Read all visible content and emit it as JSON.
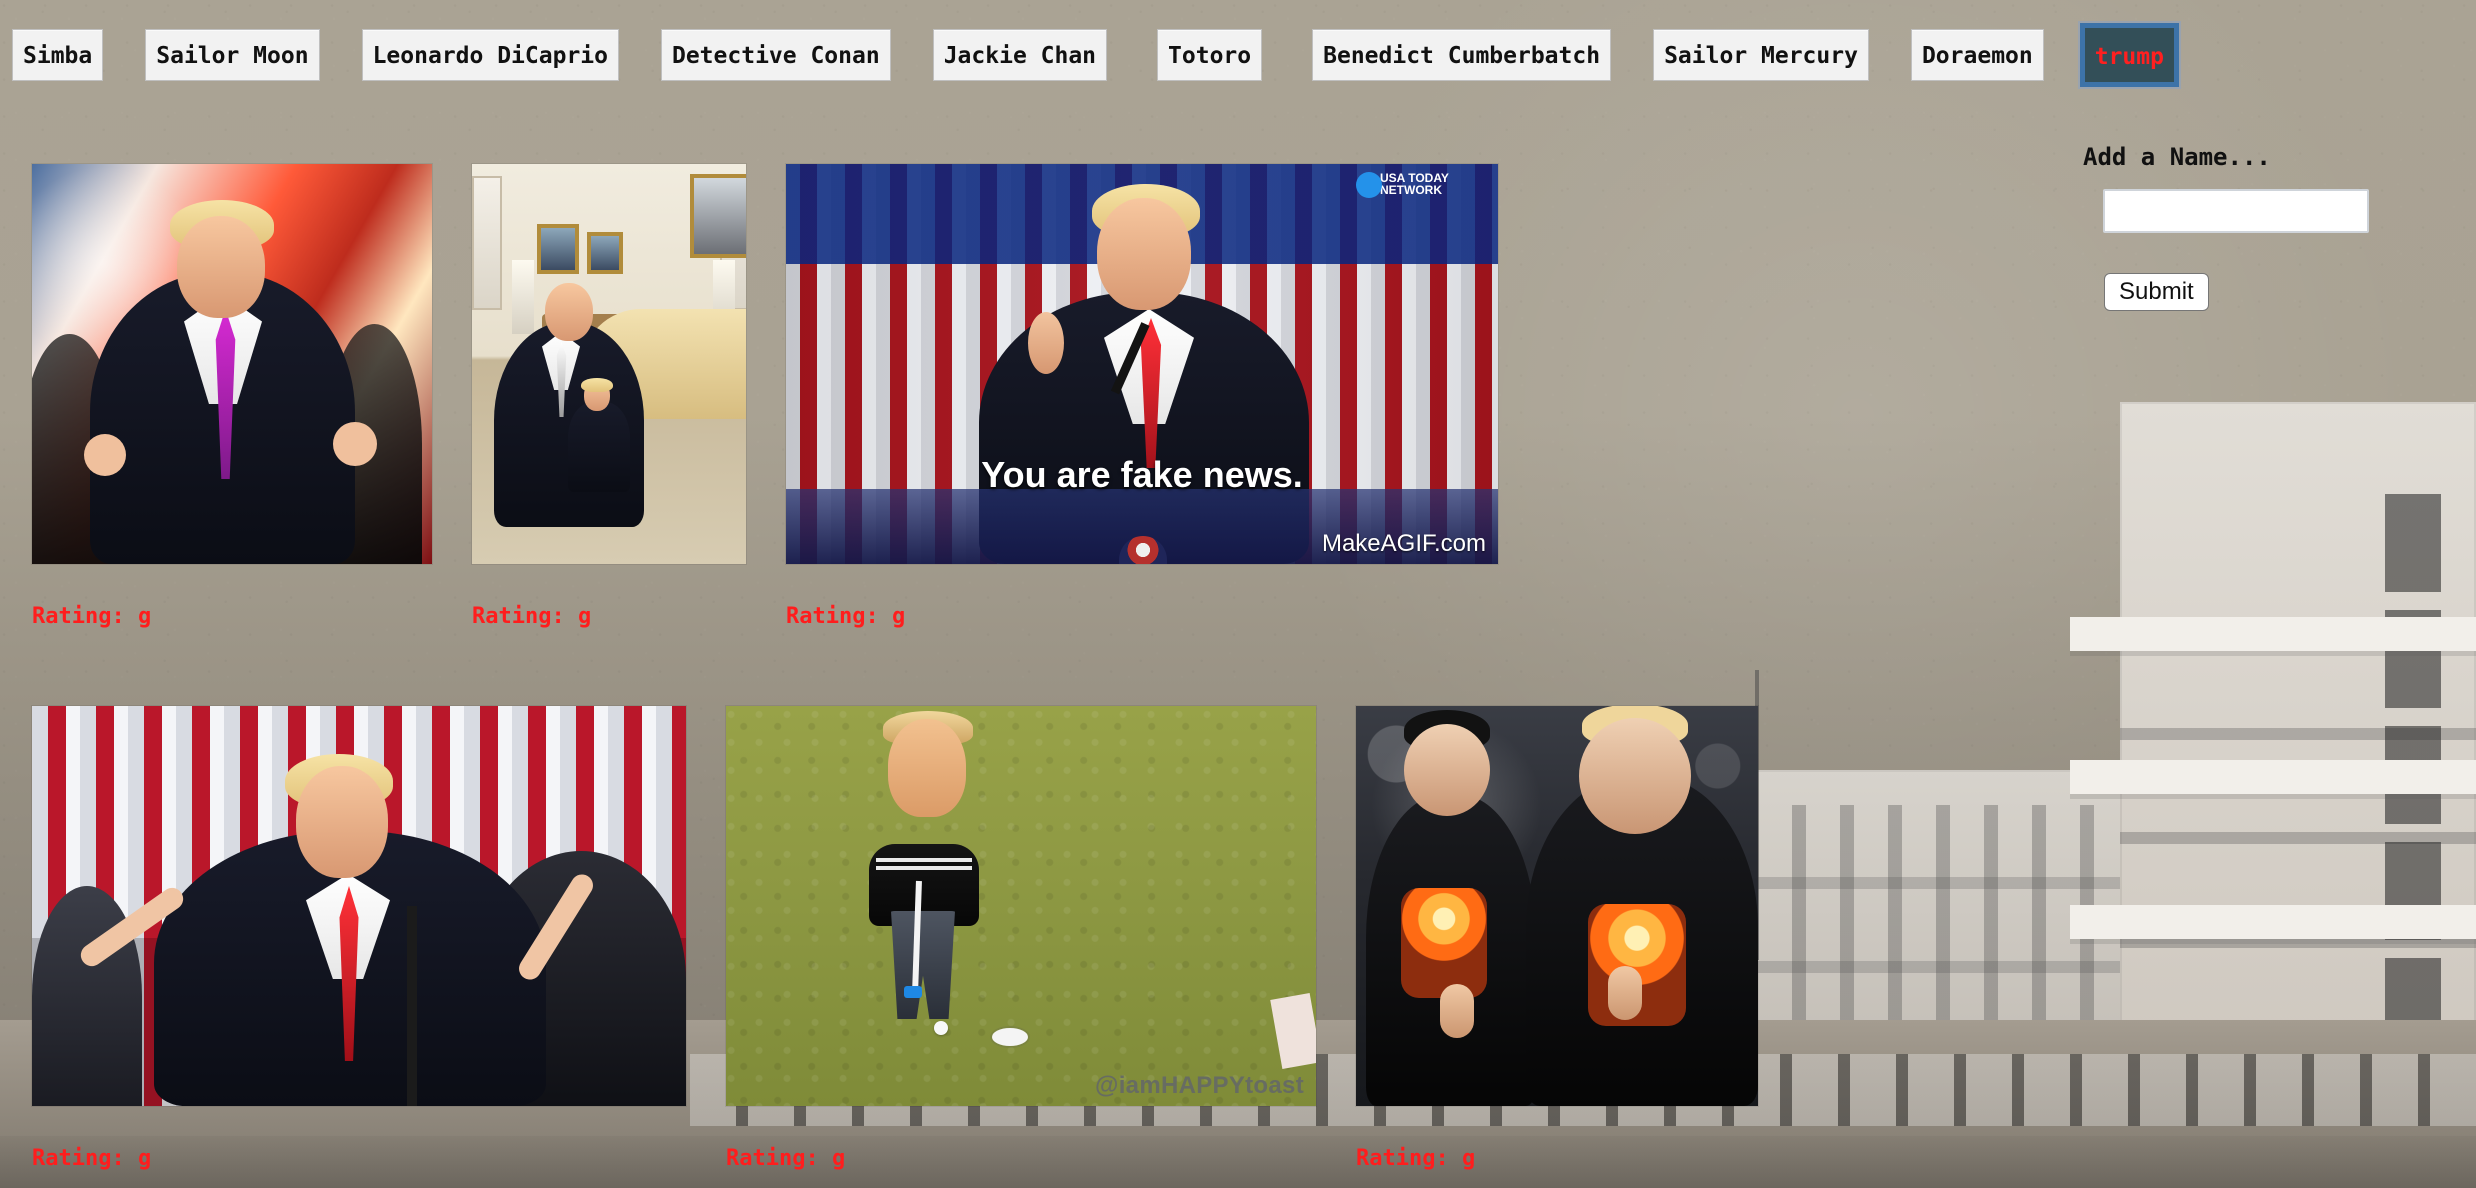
{
  "top_buttons": {
    "items": [
      {
        "label": "Simba"
      },
      {
        "label": "Sailor Moon"
      },
      {
        "label": "Leonardo DiCaprio"
      },
      {
        "label": "Detective Conan"
      },
      {
        "label": "Jackie Chan"
      },
      {
        "label": "Totoro"
      },
      {
        "label": "Benedict Cumberbatch"
      },
      {
        "label": "Sailor Mercury"
      },
      {
        "label": "Doraemon"
      },
      {
        "label": "trump"
      }
    ],
    "active_label": "trump"
  },
  "gallery": {
    "cards": [
      {
        "rating_text": "Rating: g"
      },
      {
        "rating_text": "Rating: g"
      },
      {
        "rating_text": "Rating: g",
        "caption": "You are fake news.",
        "watermark": "MakeAGIF.com",
        "network_logo": "USA TODAY NETWORK"
      },
      {
        "rating_text": "Rating: g"
      },
      {
        "rating_text": "Rating: g",
        "watermark": "@iamHAPPYtoast"
      },
      {
        "rating_text": "Rating: g"
      }
    ]
  },
  "sidebar": {
    "title": "Add a Name...",
    "input_value": "",
    "submit_label": "Submit"
  },
  "colors": {
    "accent_red": "#ff1d1d",
    "active_button_bg": "#334f58",
    "active_button_border": "#3d73a8",
    "page_background": "#a9a293"
  }
}
